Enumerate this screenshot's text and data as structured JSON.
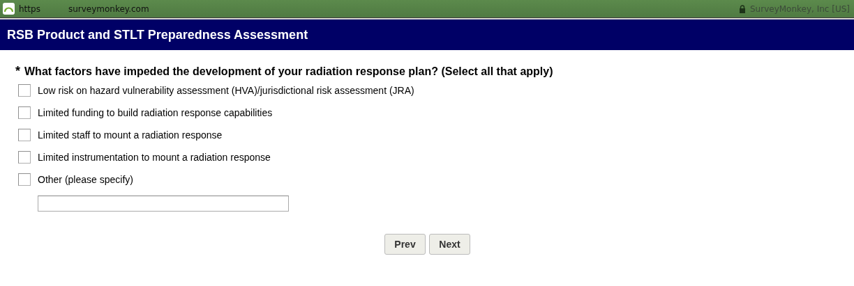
{
  "browser": {
    "scheme": "https",
    "domain": "surveymonkey.com",
    "certificate": "SurveyMonkey, Inc [US]"
  },
  "survey_title": "RSB Product and STLT Preparedness Assessment",
  "question": {
    "required_mark": "*",
    "text": "What factors have impeded the development of your radiation response plan? (Select all that apply)",
    "options": [
      {
        "label": "Low risk on hazard vulnerability assessment (HVA)/jurisdictional risk assessment (JRA)",
        "checked": false
      },
      {
        "label": "Limited funding to build radiation response capabilities",
        "checked": false
      },
      {
        "label": "Limited staff to mount a radiation response",
        "checked": false
      },
      {
        "label": "Limited instrumentation to mount a radiation response",
        "checked": false
      },
      {
        "label": "Other (please specify)",
        "checked": false
      }
    ]
  },
  "buttons": [
    "Prev",
    "Next"
  ]
}
